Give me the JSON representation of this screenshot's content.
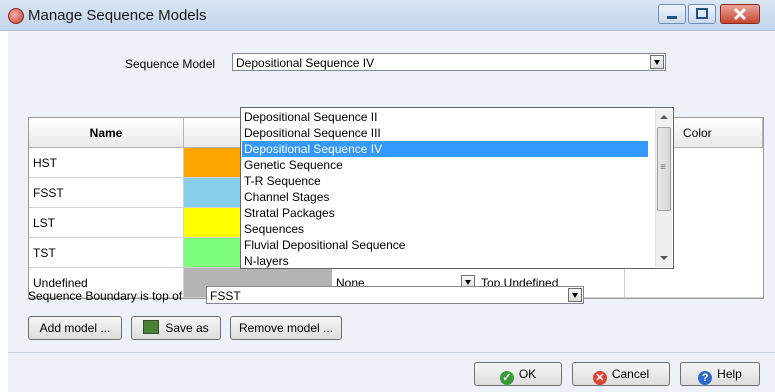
{
  "window": {
    "title": "Manage Sequence Models"
  },
  "sequence_model": {
    "label": "Sequence Model",
    "value": "Depositional Sequence IV",
    "options": [
      "Depositional Sequence II",
      "Depositional Sequence III",
      "Depositional Sequence IV",
      "Genetic Sequence",
      "T-R Sequence",
      "Channel Stages",
      "Stratal Packages",
      "Sequences",
      "Fluvial Depositional Sequence",
      "N-layers"
    ],
    "selected_index": 2
  },
  "grid": {
    "headers": [
      "Name",
      "",
      "",
      "",
      "Color"
    ],
    "rows": [
      {
        "name": "HST",
        "color": "#ffa500"
      },
      {
        "name": "FSST",
        "color": "#87ceeb"
      },
      {
        "name": "LST",
        "color": "#ffff00"
      },
      {
        "name": "TST",
        "color": "#7cfc7c"
      },
      {
        "name": "Undefined",
        "color": "#b4b4b4",
        "surface": "None",
        "top": "Top Undefined"
      }
    ]
  },
  "boundary": {
    "label": "Sequence Boundary is top of",
    "value": "FSST"
  },
  "buttons": {
    "add_model": "Add model ...",
    "save_as": "Save as",
    "remove_model": "Remove model ...",
    "ok": "OK",
    "cancel": "Cancel",
    "help": "Help"
  },
  "colors": {
    "selection": "#3399ff"
  }
}
